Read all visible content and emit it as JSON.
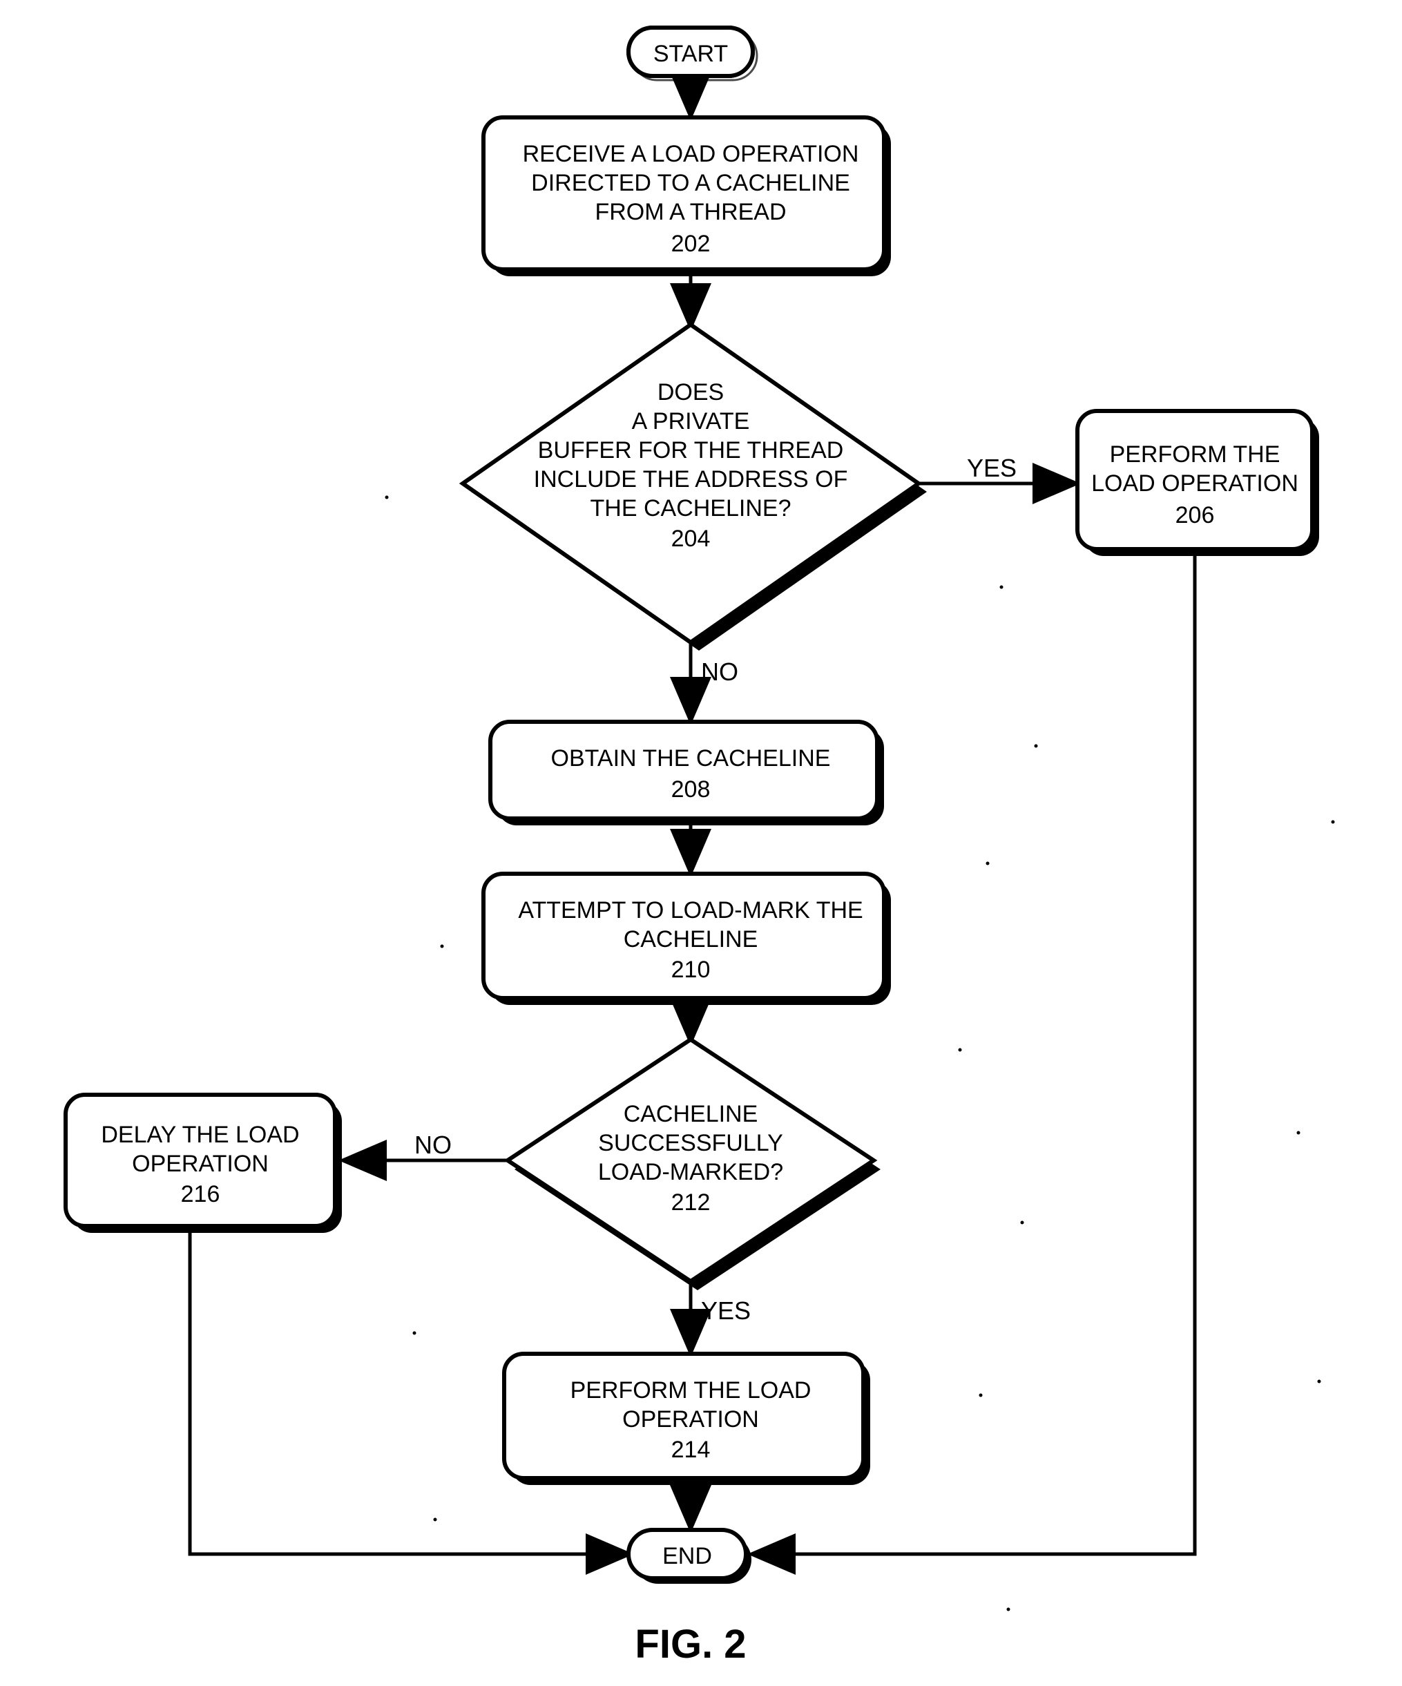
{
  "chart_data": {
    "type": "flowchart",
    "title": "FIG. 2",
    "nodes": [
      {
        "id": "start",
        "shape": "pill",
        "text": "START"
      },
      {
        "id": "n202",
        "shape": "box",
        "lines": [
          "RECEIVE A LOAD OPERATION",
          "DIRECTED TO A CACHELINE",
          "FROM A THREAD",
          "202"
        ]
      },
      {
        "id": "n204",
        "shape": "diamond",
        "lines": [
          "DOES",
          "A PRIVATE",
          "BUFFER FOR THE THREAD",
          "INCLUDE THE ADDRESS OF",
          "THE CACHELINE?",
          "204"
        ]
      },
      {
        "id": "n206",
        "shape": "box",
        "lines": [
          "PERFORM THE",
          "LOAD OPERATION",
          "206"
        ]
      },
      {
        "id": "n208",
        "shape": "box",
        "lines": [
          "OBTAIN THE CACHELINE",
          "208"
        ]
      },
      {
        "id": "n210",
        "shape": "box",
        "lines": [
          "ATTEMPT TO LOAD-MARK THE",
          "CACHELINE",
          "210"
        ]
      },
      {
        "id": "n212",
        "shape": "diamond",
        "lines": [
          "CACHELINE",
          "SUCCESSFULLY",
          "LOAD-MARKED?",
          "212"
        ]
      },
      {
        "id": "n214",
        "shape": "box",
        "lines": [
          "PERFORM THE LOAD",
          "OPERATION",
          "214"
        ]
      },
      {
        "id": "n216",
        "shape": "box",
        "lines": [
          "DELAY THE LOAD",
          "OPERATION",
          "216"
        ]
      },
      {
        "id": "end",
        "shape": "pill",
        "text": "END"
      }
    ],
    "edges": [
      {
        "from": "start",
        "to": "n202"
      },
      {
        "from": "n202",
        "to": "n204"
      },
      {
        "from": "n204",
        "to": "n206",
        "label": "YES"
      },
      {
        "from": "n204",
        "to": "n208",
        "label": "NO"
      },
      {
        "from": "n208",
        "to": "n210"
      },
      {
        "from": "n210",
        "to": "n212"
      },
      {
        "from": "n212",
        "to": "n216",
        "label": "NO"
      },
      {
        "from": "n212",
        "to": "n214",
        "label": "YES"
      },
      {
        "from": "n214",
        "to": "end"
      },
      {
        "from": "n216",
        "to": "end"
      },
      {
        "from": "n206",
        "to": "end"
      }
    ]
  },
  "labels": {
    "start": "START",
    "end": "END",
    "yes": "YES",
    "no": "NO",
    "fig": "FIG. 2",
    "n202_l1": "RECEIVE A LOAD OPERATION",
    "n202_l2": "DIRECTED TO A CACHELINE",
    "n202_l3": "FROM A THREAD",
    "n202_l4": "202",
    "n204_l1": "DOES",
    "n204_l2": "A PRIVATE",
    "n204_l3": "BUFFER FOR THE THREAD",
    "n204_l4": "INCLUDE THE ADDRESS OF",
    "n204_l5": "THE CACHELINE?",
    "n204_l6": "204",
    "n206_l1": "PERFORM THE",
    "n206_l2": "LOAD OPERATION",
    "n206_l3": "206",
    "n208_l1": "OBTAIN THE CACHELINE",
    "n208_l2": "208",
    "n210_l1": "ATTEMPT TO LOAD-MARK THE",
    "n210_l2": "CACHELINE",
    "n210_l3": "210",
    "n212_l1": "CACHELINE",
    "n212_l2": "SUCCESSFULLY",
    "n212_l3": "LOAD-MARKED?",
    "n212_l4": "212",
    "n214_l1": "PERFORM THE LOAD",
    "n214_l2": "OPERATION",
    "n214_l3": "214",
    "n216_l1": "DELAY THE LOAD",
    "n216_l2": "OPERATION",
    "n216_l3": "216"
  }
}
